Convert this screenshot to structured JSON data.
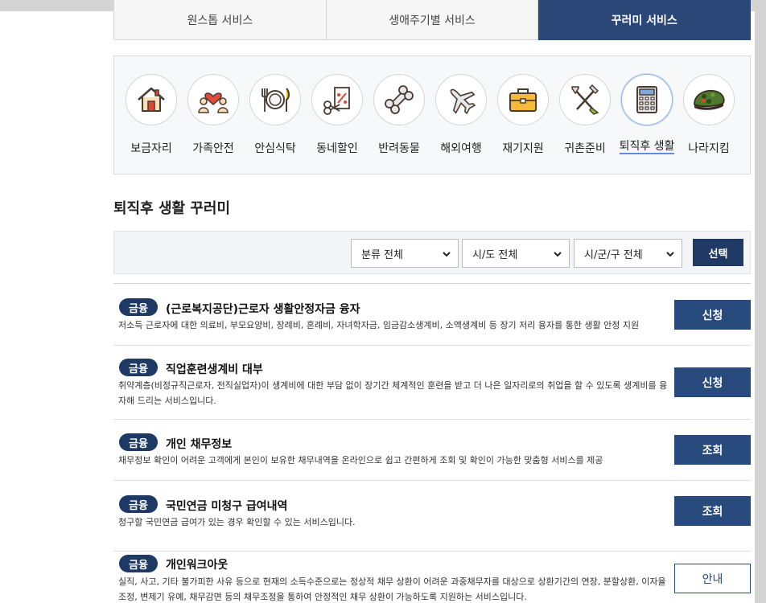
{
  "tabs": [
    {
      "label": "원스톱 서비스"
    },
    {
      "label": "생애주기별 서비스"
    },
    {
      "label": "꾸러미 서비스"
    }
  ],
  "categories": [
    {
      "label": "보금자리",
      "icon": "house-icon"
    },
    {
      "label": "가족안전",
      "icon": "family-heart-icon"
    },
    {
      "label": "안심식탁",
      "icon": "dining-icon"
    },
    {
      "label": "동네할인",
      "icon": "discount-tag-icon"
    },
    {
      "label": "반려동물",
      "icon": "bone-icon"
    },
    {
      "label": "해외여행",
      "icon": "airplane-icon"
    },
    {
      "label": "재기지원",
      "icon": "briefcase-icon"
    },
    {
      "label": "귀촌준비",
      "icon": "farm-tools-icon"
    },
    {
      "label": "퇴직후 생활",
      "icon": "calculator-icon"
    },
    {
      "label": "나라지킴",
      "icon": "military-beret-icon"
    }
  ],
  "section_title": "퇴직후 생활 꾸러미",
  "filters": {
    "category": "분류 전체",
    "province": "시/도 전체",
    "district": "시/군/구 전체",
    "select_label": "선택"
  },
  "items": [
    {
      "badge": "금융",
      "title": "(근로복지공단)근로자 생활안정자금 융자",
      "desc": "저소득 근로자에 대한 의료비, 부모요양비, 장례비, 혼례비, 자녀학자금, 임금감소생계비, 소액생계비 등 장기 저리 융자를 통한 생활 안정 지원",
      "action": "신청"
    },
    {
      "badge": "금융",
      "title": "직업훈련생계비 대부",
      "desc": "취약계층(비정규직근로자, 전직실업자)이 생계비에 대한 부담 없이 장기간 체계적인 훈련을 받고 더 나은 일자리로의 취업을 할 수 있도록 생계비를 융자해 드리는 서비스입니다.",
      "action": "신청"
    },
    {
      "badge": "금융",
      "title": "개인 채무정보",
      "desc": "채무정보 확인이 어려운 고객에게 본인이 보유한 채무내역을 온라인으로 쉽고 간편하게 조회 및 확인이 가능한 맞춤형 서비스를 제공",
      "action": "조회"
    },
    {
      "badge": "금융",
      "title": "국민연금 미청구 급여내역",
      "desc": "청구할 국민연금 급여가 있는 경우 확인할 수 있는 서비스입니다.",
      "action": "조회"
    },
    {
      "badge": "금융",
      "title": "개인워크아웃",
      "desc": "실직, 사고, 기타 불가피한 사유 등으로 현재의 소득수준으로는 정상적 채무 상환이 어려운 과중채무자를 대상으로 상환기간의 연장, 분할상환, 이자율 조정, 변제기 유예, 채무감면 등의 채무조정을 통하여 안정적인 채무 상환이 가능하도록 지원하는 서비스입니다.",
      "action": "안내"
    }
  ]
}
